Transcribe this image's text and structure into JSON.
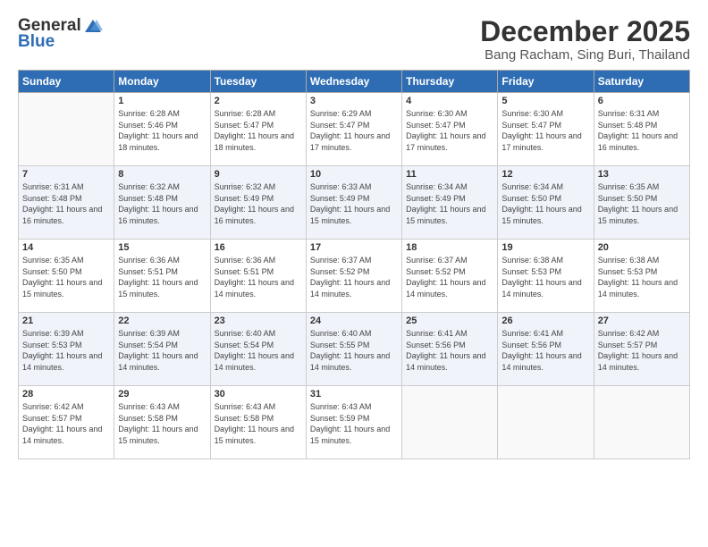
{
  "header": {
    "logo_general": "General",
    "logo_blue": "Blue",
    "month_title": "December 2025",
    "location": "Bang Racham, Sing Buri, Thailand"
  },
  "days_of_week": [
    "Sunday",
    "Monday",
    "Tuesday",
    "Wednesday",
    "Thursday",
    "Friday",
    "Saturday"
  ],
  "weeks": [
    [
      {
        "day": "",
        "sunrise": "",
        "sunset": "",
        "daylight": "",
        "empty": true
      },
      {
        "day": "1",
        "sunrise": "Sunrise: 6:28 AM",
        "sunset": "Sunset: 5:46 PM",
        "daylight": "Daylight: 11 hours and 18 minutes."
      },
      {
        "day": "2",
        "sunrise": "Sunrise: 6:28 AM",
        "sunset": "Sunset: 5:47 PM",
        "daylight": "Daylight: 11 hours and 18 minutes."
      },
      {
        "day": "3",
        "sunrise": "Sunrise: 6:29 AM",
        "sunset": "Sunset: 5:47 PM",
        "daylight": "Daylight: 11 hours and 17 minutes."
      },
      {
        "day": "4",
        "sunrise": "Sunrise: 6:30 AM",
        "sunset": "Sunset: 5:47 PM",
        "daylight": "Daylight: 11 hours and 17 minutes."
      },
      {
        "day": "5",
        "sunrise": "Sunrise: 6:30 AM",
        "sunset": "Sunset: 5:47 PM",
        "daylight": "Daylight: 11 hours and 17 minutes."
      },
      {
        "day": "6",
        "sunrise": "Sunrise: 6:31 AM",
        "sunset": "Sunset: 5:48 PM",
        "daylight": "Daylight: 11 hours and 16 minutes."
      }
    ],
    [
      {
        "day": "7",
        "sunrise": "Sunrise: 6:31 AM",
        "sunset": "Sunset: 5:48 PM",
        "daylight": "Daylight: 11 hours and 16 minutes."
      },
      {
        "day": "8",
        "sunrise": "Sunrise: 6:32 AM",
        "sunset": "Sunset: 5:48 PM",
        "daylight": "Daylight: 11 hours and 16 minutes."
      },
      {
        "day": "9",
        "sunrise": "Sunrise: 6:32 AM",
        "sunset": "Sunset: 5:49 PM",
        "daylight": "Daylight: 11 hours and 16 minutes."
      },
      {
        "day": "10",
        "sunrise": "Sunrise: 6:33 AM",
        "sunset": "Sunset: 5:49 PM",
        "daylight": "Daylight: 11 hours and 15 minutes."
      },
      {
        "day": "11",
        "sunrise": "Sunrise: 6:34 AM",
        "sunset": "Sunset: 5:49 PM",
        "daylight": "Daylight: 11 hours and 15 minutes."
      },
      {
        "day": "12",
        "sunrise": "Sunrise: 6:34 AM",
        "sunset": "Sunset: 5:50 PM",
        "daylight": "Daylight: 11 hours and 15 minutes."
      },
      {
        "day": "13",
        "sunrise": "Sunrise: 6:35 AM",
        "sunset": "Sunset: 5:50 PM",
        "daylight": "Daylight: 11 hours and 15 minutes."
      }
    ],
    [
      {
        "day": "14",
        "sunrise": "Sunrise: 6:35 AM",
        "sunset": "Sunset: 5:50 PM",
        "daylight": "Daylight: 11 hours and 15 minutes."
      },
      {
        "day": "15",
        "sunrise": "Sunrise: 6:36 AM",
        "sunset": "Sunset: 5:51 PM",
        "daylight": "Daylight: 11 hours and 15 minutes."
      },
      {
        "day": "16",
        "sunrise": "Sunrise: 6:36 AM",
        "sunset": "Sunset: 5:51 PM",
        "daylight": "Daylight: 11 hours and 14 minutes."
      },
      {
        "day": "17",
        "sunrise": "Sunrise: 6:37 AM",
        "sunset": "Sunset: 5:52 PM",
        "daylight": "Daylight: 11 hours and 14 minutes."
      },
      {
        "day": "18",
        "sunrise": "Sunrise: 6:37 AM",
        "sunset": "Sunset: 5:52 PM",
        "daylight": "Daylight: 11 hours and 14 minutes."
      },
      {
        "day": "19",
        "sunrise": "Sunrise: 6:38 AM",
        "sunset": "Sunset: 5:53 PM",
        "daylight": "Daylight: 11 hours and 14 minutes."
      },
      {
        "day": "20",
        "sunrise": "Sunrise: 6:38 AM",
        "sunset": "Sunset: 5:53 PM",
        "daylight": "Daylight: 11 hours and 14 minutes."
      }
    ],
    [
      {
        "day": "21",
        "sunrise": "Sunrise: 6:39 AM",
        "sunset": "Sunset: 5:53 PM",
        "daylight": "Daylight: 11 hours and 14 minutes."
      },
      {
        "day": "22",
        "sunrise": "Sunrise: 6:39 AM",
        "sunset": "Sunset: 5:54 PM",
        "daylight": "Daylight: 11 hours and 14 minutes."
      },
      {
        "day": "23",
        "sunrise": "Sunrise: 6:40 AM",
        "sunset": "Sunset: 5:54 PM",
        "daylight": "Daylight: 11 hours and 14 minutes."
      },
      {
        "day": "24",
        "sunrise": "Sunrise: 6:40 AM",
        "sunset": "Sunset: 5:55 PM",
        "daylight": "Daylight: 11 hours and 14 minutes."
      },
      {
        "day": "25",
        "sunrise": "Sunrise: 6:41 AM",
        "sunset": "Sunset: 5:56 PM",
        "daylight": "Daylight: 11 hours and 14 minutes."
      },
      {
        "day": "26",
        "sunrise": "Sunrise: 6:41 AM",
        "sunset": "Sunset: 5:56 PM",
        "daylight": "Daylight: 11 hours and 14 minutes."
      },
      {
        "day": "27",
        "sunrise": "Sunrise: 6:42 AM",
        "sunset": "Sunset: 5:57 PM",
        "daylight": "Daylight: 11 hours and 14 minutes."
      }
    ],
    [
      {
        "day": "28",
        "sunrise": "Sunrise: 6:42 AM",
        "sunset": "Sunset: 5:57 PM",
        "daylight": "Daylight: 11 hours and 14 minutes."
      },
      {
        "day": "29",
        "sunrise": "Sunrise: 6:43 AM",
        "sunset": "Sunset: 5:58 PM",
        "daylight": "Daylight: 11 hours and 15 minutes."
      },
      {
        "day": "30",
        "sunrise": "Sunrise: 6:43 AM",
        "sunset": "Sunset: 5:58 PM",
        "daylight": "Daylight: 11 hours and 15 minutes."
      },
      {
        "day": "31",
        "sunrise": "Sunrise: 6:43 AM",
        "sunset": "Sunset: 5:59 PM",
        "daylight": "Daylight: 11 hours and 15 minutes."
      },
      {
        "day": "",
        "sunrise": "",
        "sunset": "",
        "daylight": "",
        "empty": true
      },
      {
        "day": "",
        "sunrise": "",
        "sunset": "",
        "daylight": "",
        "empty": true
      },
      {
        "day": "",
        "sunrise": "",
        "sunset": "",
        "daylight": "",
        "empty": true
      }
    ]
  ]
}
